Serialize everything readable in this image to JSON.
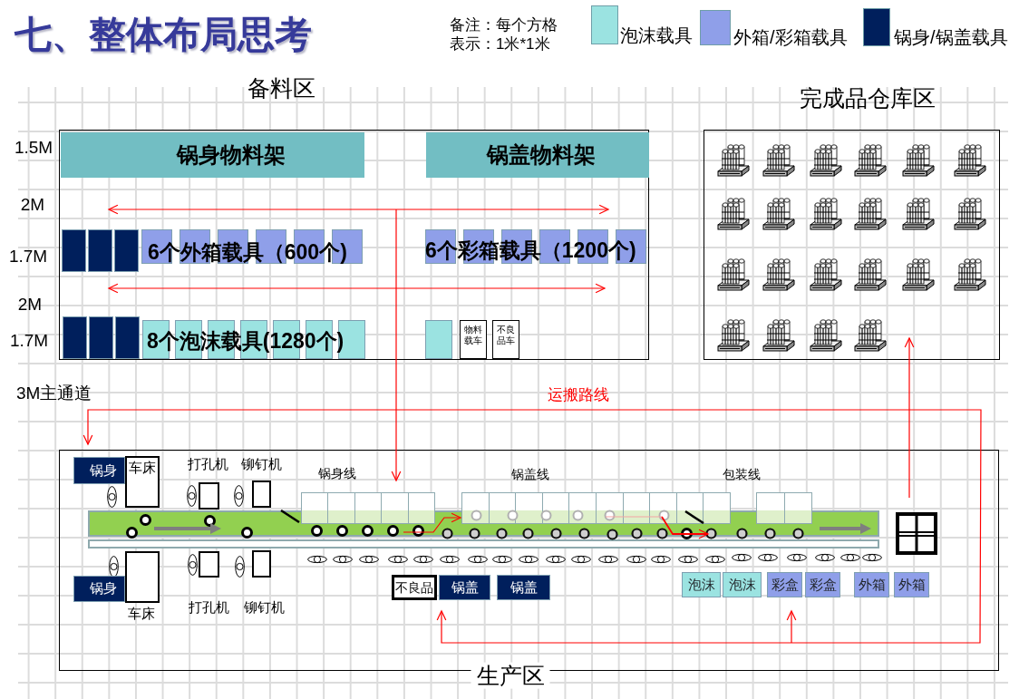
{
  "title": "七、整体布局思考",
  "note": [
    "备注：每个方格",
    "表示：1米*1米"
  ],
  "legend": [
    {
      "kind": "foam",
      "label": "泡沫载具",
      "color": "#9be3e1"
    },
    {
      "kind": "carton",
      "label": "外箱/彩箱载具",
      "color": "#8f9fe9"
    },
    {
      "kind": "pot",
      "label": "锅身/锅盖载具",
      "color": "#001f5c"
    }
  ],
  "staging_area": {
    "title": "备料区",
    "dimension_labels": [
      "1.5M",
      "2M",
      "1.7M",
      "2M",
      "1.7M"
    ],
    "racks": [
      "锅身物料架",
      "锅盖物料架"
    ],
    "carrier_rows": [
      {
        "left": {
          "carriers": [
            {
              "kind": "pot"
            },
            {
              "kind": "pot"
            },
            {
              "kind": "pot"
            },
            {
              "kind": "carton"
            },
            {
              "kind": "carton"
            },
            {
              "kind": "carton"
            },
            {
              "kind": "carton"
            },
            {
              "kind": "carton"
            },
            {
              "kind": "carton"
            }
          ],
          "caption": "6个外箱载具（600个)"
        },
        "right": {
          "carriers": [
            {
              "kind": "carton"
            },
            {
              "kind": "carton"
            },
            {
              "kind": "carton"
            },
            {
              "kind": "carton"
            },
            {
              "kind": "carton"
            },
            {
              "kind": "carton"
            }
          ],
          "caption": "6个彩箱载具（1200个)"
        }
      },
      {
        "left": {
          "carriers": [
            {
              "kind": "pot"
            },
            {
              "kind": "pot"
            },
            {
              "kind": "pot"
            },
            {
              "kind": "foam"
            },
            {
              "kind": "foam"
            },
            {
              "kind": "foam"
            },
            {
              "kind": "foam"
            },
            {
              "kind": "foam"
            },
            {
              "kind": "foam"
            },
            {
              "kind": "foam"
            }
          ],
          "caption": "8个泡沫载具(1280个)"
        },
        "right": {
          "carriers": [
            {
              "kind": "foam"
            },
            {
              "kind": "cart",
              "label": "物料载车"
            },
            {
              "kind": "cart",
              "label": "不良品车"
            }
          ]
        }
      }
    ]
  },
  "aisle_label": "3M主通道",
  "route_label": "运搬路线",
  "warehouse": {
    "title": "完成品仓库区"
  },
  "production": {
    "title": "生产区",
    "upper_side": {
      "part": "锅身",
      "machines": [
        "车床",
        "打孔机",
        "铆钉机"
      ]
    },
    "lower_side": {
      "part": "锅身",
      "machines": [
        "车床",
        "打孔机",
        "铆钉机"
      ]
    },
    "lines": [
      "锅身线",
      "锅盖线",
      "包装线"
    ],
    "bins": [
      {
        "kind": "reject",
        "label": "不良品"
      },
      {
        "kind": "pot",
        "label": "锅盖"
      },
      {
        "kind": "pot",
        "label": "锅盖"
      },
      {
        "kind": "foam",
        "label": "泡沫"
      },
      {
        "kind": "foam",
        "label": "泡沫"
      },
      {
        "kind": "carton",
        "label": "彩盒"
      },
      {
        "kind": "carton",
        "label": "彩盒"
      },
      {
        "kind": "carton",
        "label": "外箱"
      },
      {
        "kind": "carton",
        "label": "外箱"
      }
    ]
  }
}
